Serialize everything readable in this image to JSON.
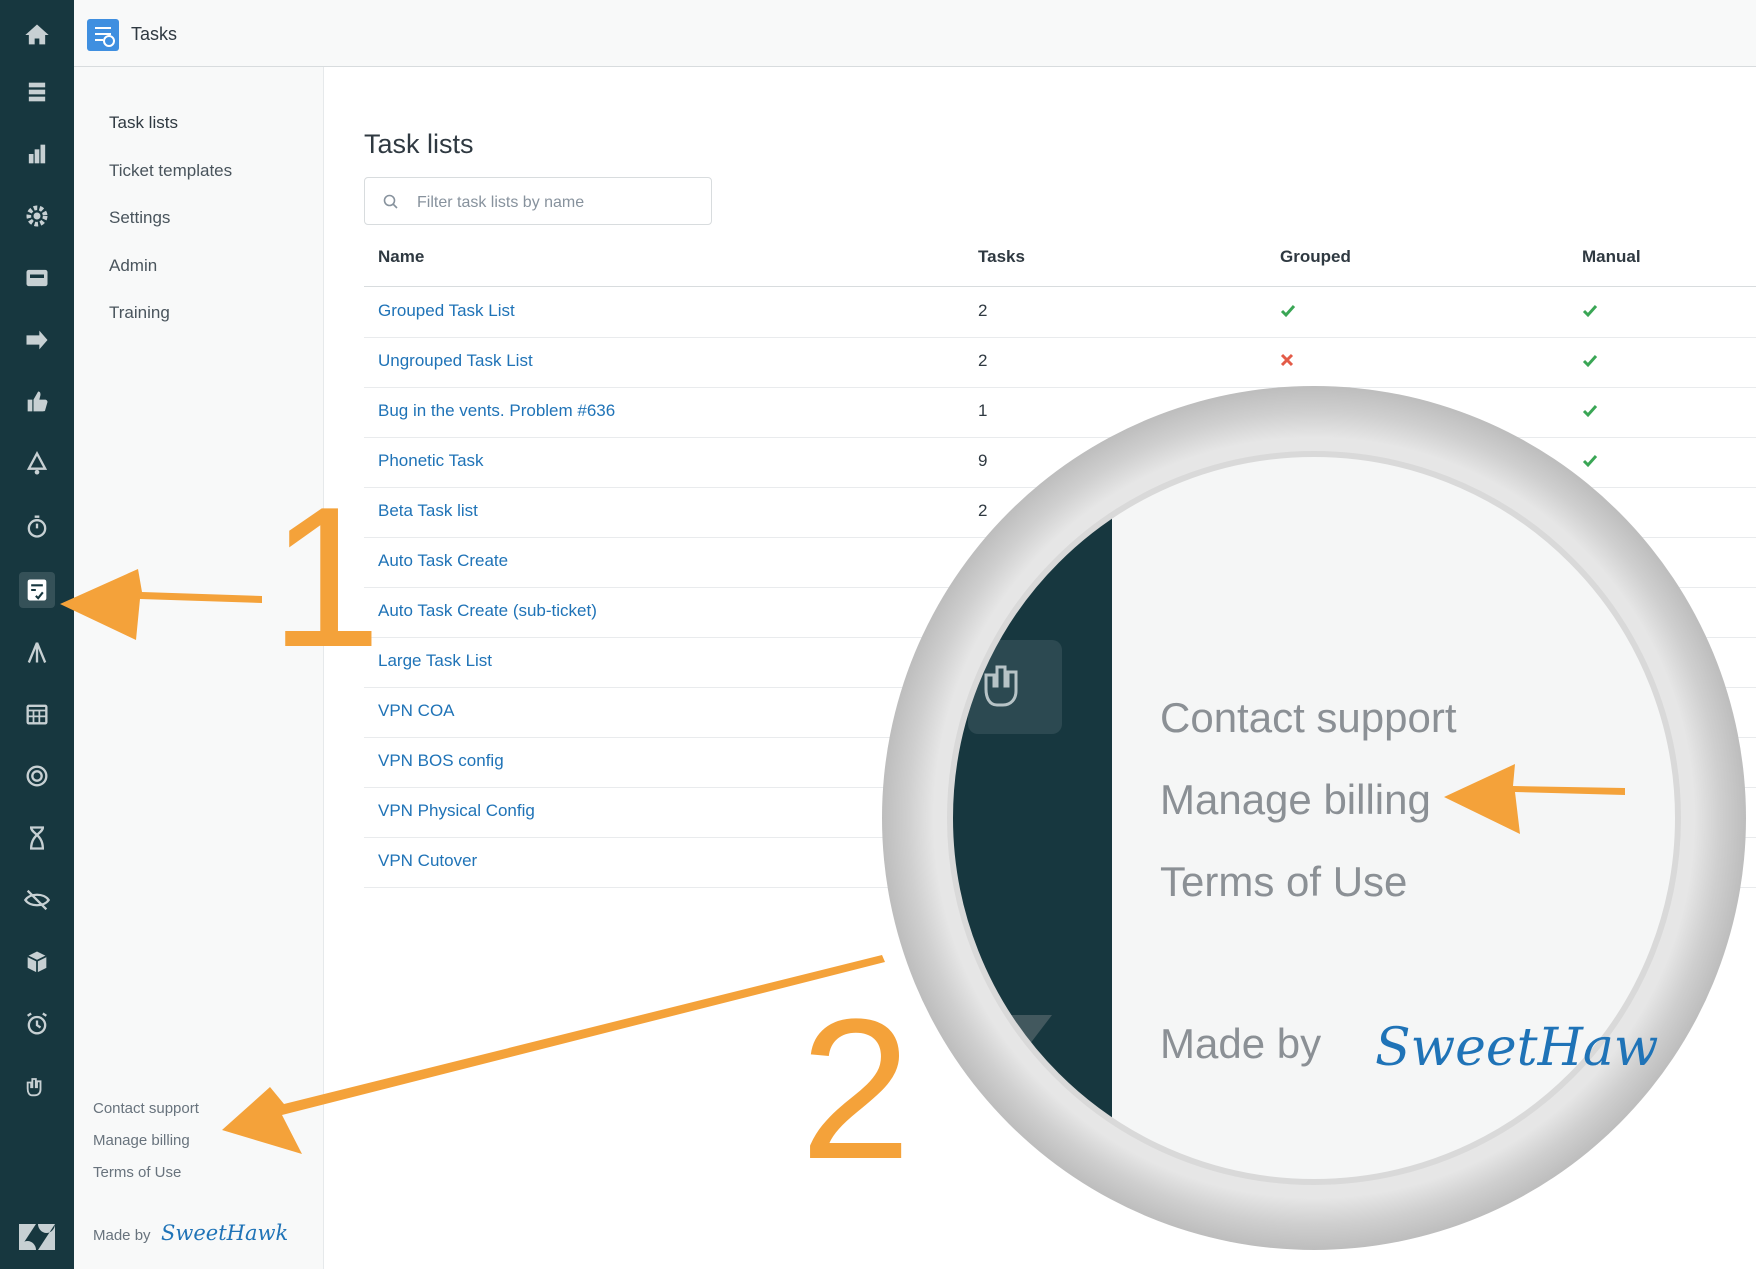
{
  "app": {
    "title": "Tasks"
  },
  "sidebar": {
    "items": [
      {
        "label": "Task lists"
      },
      {
        "label": "Ticket templates"
      },
      {
        "label": "Settings"
      },
      {
        "label": "Admin"
      },
      {
        "label": "Training"
      }
    ],
    "footer": {
      "contact": "Contact support",
      "billing": "Manage billing",
      "terms": "Terms of Use",
      "made_by": "Made by",
      "brand": "SweetHawk"
    }
  },
  "main": {
    "title": "Task lists",
    "search_placeholder": "Filter task lists by name",
    "columns": {
      "name": "Name",
      "tasks": "Tasks",
      "grouped": "Grouped",
      "manual": "Manual"
    },
    "rows": [
      {
        "name": "Grouped Task List",
        "tasks": "2",
        "grouped": "check",
        "manual": "check"
      },
      {
        "name": "Ungrouped Task List",
        "tasks": "2",
        "grouped": "cross",
        "manual": "check"
      },
      {
        "name": "Bug in the vents. Problem #636",
        "tasks": "1",
        "grouped": "",
        "manual": "check"
      },
      {
        "name": "Phonetic Task",
        "tasks": "9",
        "grouped": "",
        "manual": "check"
      },
      {
        "name": "Beta Task list",
        "tasks": "2",
        "grouped": "",
        "manual": ""
      },
      {
        "name": "Auto Task Create",
        "tasks": "",
        "grouped": "",
        "manual": ""
      },
      {
        "name": "Auto Task Create (sub-ticket)",
        "tasks": "",
        "grouped": "",
        "manual": ""
      },
      {
        "name": "Large Task List",
        "tasks": "",
        "grouped": "",
        "manual": ""
      },
      {
        "name": "VPN COA",
        "tasks": "",
        "grouped": "",
        "manual": ""
      },
      {
        "name": "VPN BOS config",
        "tasks": "",
        "grouped": "",
        "manual": ""
      },
      {
        "name": "VPN Physical Config",
        "tasks": "",
        "grouped": "",
        "manual": ""
      },
      {
        "name": "VPN Cutover",
        "tasks": "",
        "grouped": "",
        "manual": ""
      }
    ]
  },
  "annotations": {
    "step1": "1",
    "step2": "2",
    "magnifier": {
      "contact": "Contact support",
      "billing": "Manage billing",
      "terms": "Terms of Use",
      "made_by": "Made by",
      "brand": "SweetHaw"
    }
  },
  "colors": {
    "rail": "#17373f",
    "link": "#1f73b7",
    "check": "#3aa655",
    "cross": "#e35b48",
    "annotation": "#f4a23a"
  },
  "rail_icons": [
    "home-icon",
    "views-icon",
    "reporting-icon",
    "admin-gear-icon",
    "store-icon",
    "forward-icon",
    "thumbs-up-icon",
    "notification-icon",
    "timer-icon",
    "tasks-app-icon",
    "tripod-icon",
    "calendar-icon",
    "target-icon",
    "hourglass-icon",
    "hidden-eye-icon",
    "box-icon",
    "alarm-clock-icon",
    "hand-gesture-icon"
  ]
}
